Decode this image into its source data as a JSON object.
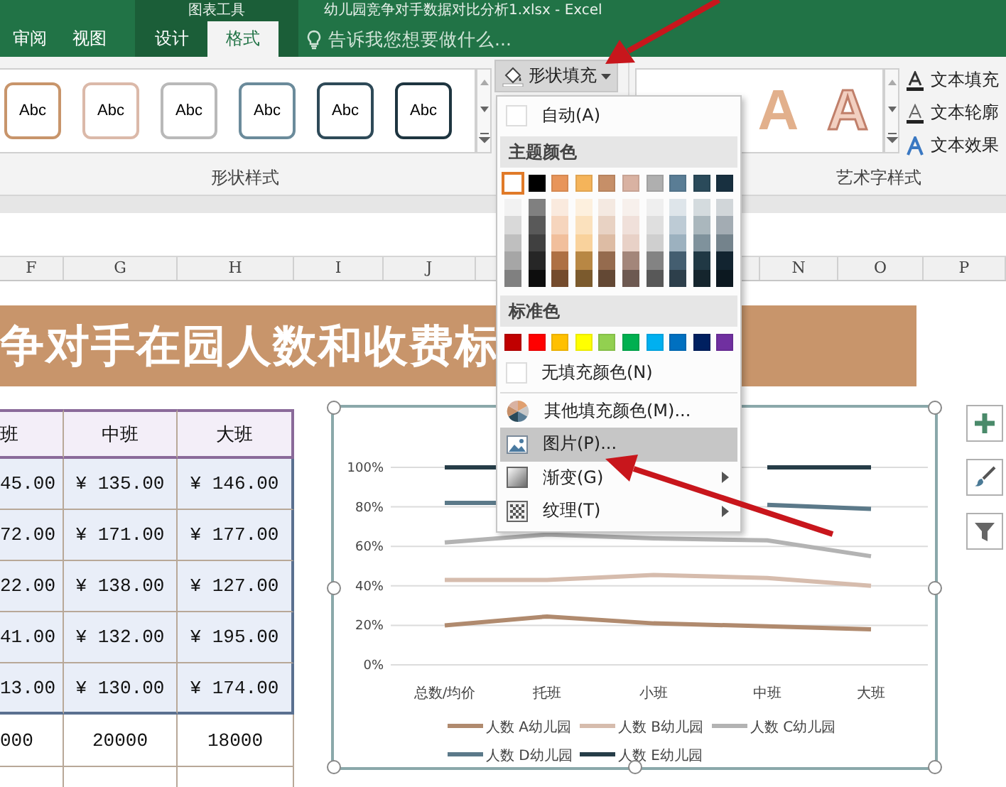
{
  "title_bar": {
    "context_label": "图表工具",
    "title": "幼儿园竞争对手数据对比分析1.xlsx - Excel"
  },
  "tabs": [
    {
      "label": "审阅",
      "selected": false,
      "contextual": false
    },
    {
      "label": "视图",
      "selected": false,
      "contextual": false
    },
    {
      "label": "设计",
      "selected": false,
      "contextual": true
    },
    {
      "label": "格式",
      "selected": true,
      "contextual": true
    }
  ],
  "tell_me": {
    "placeholder": "告诉我您想要做什么..."
  },
  "ribbon": {
    "shape_styles": {
      "group_label": "形状样式",
      "items": [
        {
          "label": "Abc",
          "color": "#c8956b"
        },
        {
          "label": "Abc",
          "color": "#dbb9a9"
        },
        {
          "label": "Abc",
          "color": "#b9b9b9"
        },
        {
          "label": "Abc",
          "color": "#6b8b9b"
        },
        {
          "label": "Abc",
          "color": "#2e4a58"
        },
        {
          "label": "Abc",
          "color": "#1e3540"
        }
      ]
    },
    "shape_fill": {
      "label": "形状填充",
      "open": true
    },
    "wordart": {
      "group_label": "艺术字样式",
      "samples": [
        {
          "label": "A",
          "kind": "filled"
        },
        {
          "label": "A",
          "kind": "outline"
        }
      ]
    },
    "text_commands": [
      {
        "label": "文本填充",
        "kind": "fill"
      },
      {
        "label": "文本轮廓",
        "kind": "outline"
      },
      {
        "label": "文本效果",
        "kind": "effect"
      }
    ]
  },
  "columns": [
    {
      "label": "F"
    },
    {
      "label": "G"
    },
    {
      "label": "H"
    },
    {
      "label": "I"
    },
    {
      "label": "J"
    },
    {},
    {
      "label": "N"
    },
    {
      "label": "O"
    },
    {
      "label": "P"
    }
  ],
  "sheet": {
    "banner": "争对手在园人数和收费标",
    "table": {
      "header": [
        "班",
        "中班",
        "大班"
      ],
      "rows": [
        [
          "45.00",
          "¥ 135.00",
          "¥ 146.00"
        ],
        [
          "72.00",
          "¥ 171.00",
          "¥ 177.00"
        ],
        [
          "22.00",
          "¥ 138.00",
          "¥ 127.00"
        ],
        [
          "41.00",
          "¥ 132.00",
          "¥ 195.00"
        ],
        [
          "13.00",
          "¥ 130.00",
          "¥ 174.00"
        ]
      ],
      "footer_rows": [
        [
          "000",
          "20000",
          "18000"
        ]
      ]
    }
  },
  "chart": {
    "chart_data": {
      "type": "line",
      "grid": true,
      "legend": true,
      "categories": [
        "总数/均价",
        "托班",
        "小班",
        "中班",
        "大班"
      ],
      "ylim": [
        0,
        1
      ],
      "yticks": [
        {
          "value": 0,
          "label": "0%"
        },
        {
          "value": 0.2,
          "label": "20%"
        },
        {
          "value": 0.4,
          "label": "40%"
        },
        {
          "value": 0.6,
          "label": "60%"
        },
        {
          "value": 0.8,
          "label": "80%"
        },
        {
          "value": 1,
          "label": "100%"
        }
      ],
      "series": [
        {
          "name": "人数 A幼儿园",
          "color": "#b08a6e",
          "values": [
            0.2,
            0.245,
            0.21,
            0.195,
            0.18
          ]
        },
        {
          "name": "人数 B幼儿园",
          "color": "#d6bcad",
          "values": [
            0.43,
            0.43,
            0.455,
            0.44,
            0.4
          ]
        },
        {
          "name": "人数 C幼儿园",
          "color": "#b3b3b3",
          "values": [
            0.62,
            0.66,
            0.64,
            0.63,
            0.55
          ]
        },
        {
          "name": "人数 D幼儿园",
          "color": "#5b7989",
          "values": [
            0.82,
            null,
            null,
            0.81,
            0.79
          ]
        },
        {
          "name": "人数 E幼儿园",
          "color": "#263d48",
          "values": [
            1,
            null,
            null,
            1,
            1
          ]
        }
      ]
    }
  },
  "fill_menu": {
    "top_items": [
      {
        "label": "自动(A)",
        "kind": "swatch",
        "selected": false,
        "submenu": false
      }
    ],
    "theme_heading": "主题颜色",
    "theme_colors": [
      {
        "color": "#ffffff",
        "selected": true
      },
      {
        "color": "#000000",
        "selected": false
      },
      {
        "color": "#e8955a",
        "selected": false
      },
      {
        "color": "#f5b45a",
        "selected": false
      },
      {
        "color": "#c68f68",
        "selected": false
      },
      {
        "color": "#d9b2a2",
        "selected": false
      },
      {
        "color": "#afafaf",
        "selected": false
      },
      {
        "color": "#5a7d95",
        "selected": false
      },
      {
        "color": "#2a4a5a",
        "selected": false
      },
      {
        "color": "#183040",
        "selected": false
      }
    ],
    "standard_heading": "标准色",
    "standard_colors": [
      {
        "color": "#c00000",
        "selected": false
      },
      {
        "color": "#ff0000",
        "selected": false
      },
      {
        "color": "#ffc000",
        "selected": false
      },
      {
        "color": "#ffff00",
        "selected": false
      },
      {
        "color": "#92d050",
        "selected": false
      },
      {
        "color": "#00b050",
        "selected": false
      },
      {
        "color": "#00b0f0",
        "selected": false
      },
      {
        "color": "#0070c0",
        "selected": false
      },
      {
        "color": "#002060",
        "selected": false
      },
      {
        "color": "#7030a0",
        "selected": false
      }
    ],
    "items": [
      {
        "label": "无填充颜色(N)",
        "kind": "swatch",
        "selected": false,
        "submenu": false
      },
      {
        "label": "其他填充颜色(M)...",
        "kind": "wheel",
        "selected": false,
        "submenu": false
      },
      {
        "label": "图片(P)...",
        "kind": "picture",
        "selected": true,
        "submenu": false
      },
      {
        "label": "渐变(G)",
        "kind": "gradient",
        "selected": false,
        "submenu": true
      },
      {
        "label": "纹理(T)",
        "kind": "texture",
        "selected": false,
        "submenu": true
      }
    ]
  }
}
